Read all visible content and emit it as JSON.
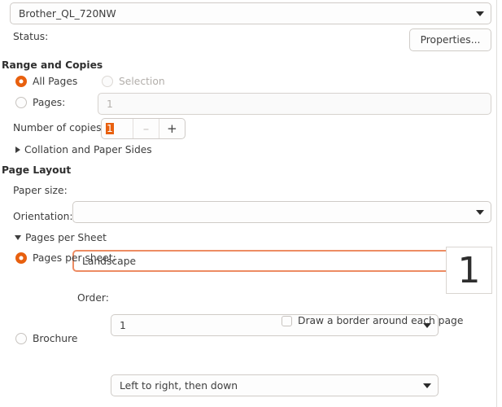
{
  "printer": {
    "selected": "Brother_QL_720NW",
    "status_label": "Status:",
    "status_value": "",
    "properties_button": "Properties..."
  },
  "range_and_copies": {
    "heading": "Range and Copies",
    "all_pages_label": "All Pages",
    "selection_label": "Selection",
    "pages_label": "Pages:",
    "pages_placeholder": "1",
    "copies_label": "Number of copies:",
    "copies_value": "1",
    "minus_label": "–",
    "plus_label": "+",
    "collation_expander": "Collation and Paper Sides"
  },
  "page_layout": {
    "heading": "Page Layout",
    "paper_size_label": "Paper size:",
    "paper_size_value": "",
    "orientation_label": "Orientation:",
    "orientation_value": "Landscape",
    "pages_per_sheet_expander": "Pages per Sheet",
    "pages_per_sheet_label": "Pages per sheet:",
    "pages_per_sheet_value": "1",
    "order_label": "Order:",
    "order_value": "Left to right, then down",
    "border_checkbox_label": "Draw a border around each page",
    "brochure_label": "Brochure",
    "preview_value": "1"
  },
  "colors": {
    "accent": "#e8600f",
    "focus_border": "#ed8c63",
    "text": "#3d3d3d",
    "disabled_text": "#b2aeaa"
  }
}
